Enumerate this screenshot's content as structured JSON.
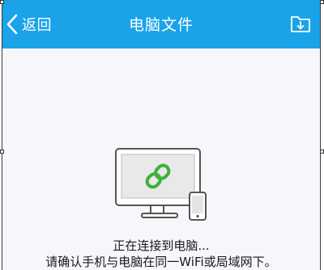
{
  "header": {
    "back_label": "返回",
    "title": "电脑文件",
    "back_icon": "chevron-left-icon",
    "download_icon": "folder-download-icon"
  },
  "status": {
    "line1": "正在连接到电脑...",
    "line2": "请确认手机与电脑在同一WiFi或局域网下。"
  },
  "illustration": {
    "icon": "link-icon",
    "devices": [
      "monitor",
      "phone"
    ]
  },
  "colors": {
    "header_bg": "#1aa3e9",
    "link_green": "#3db13d",
    "background": "#f5f7fa"
  }
}
